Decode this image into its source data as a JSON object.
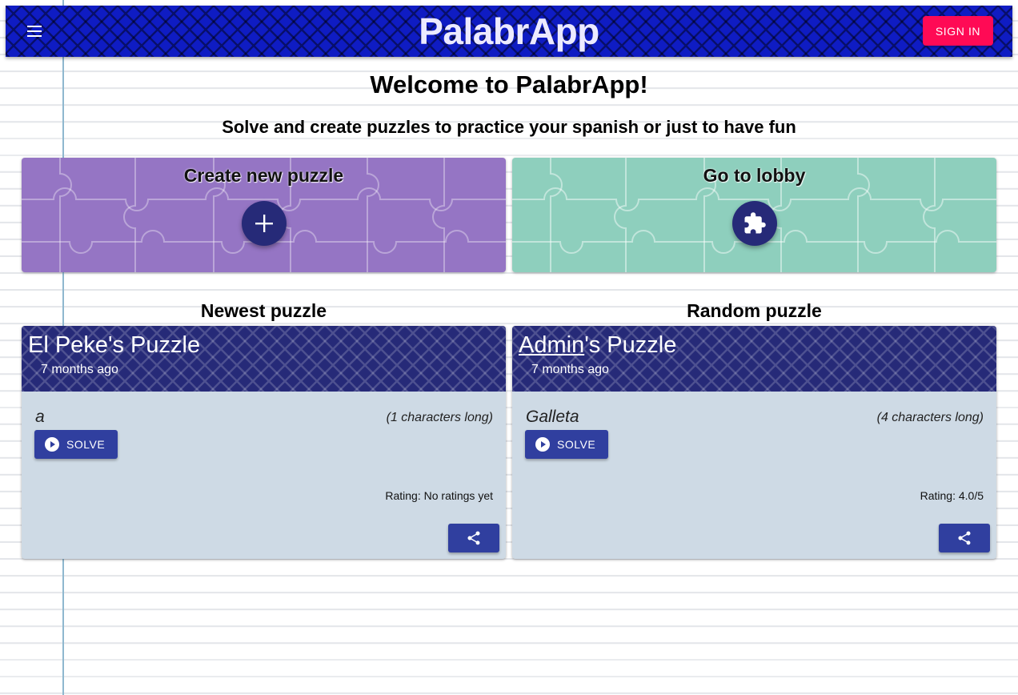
{
  "app_bar": {
    "title": "PalabrApp",
    "menu_icon": "hamburger-menu-icon",
    "sign_in_label": "SIGN IN",
    "bg_color": "#0f1cc3",
    "sign_in_color": "#ff0a55"
  },
  "hero": {
    "welcome": "Welcome to PalabrApp!",
    "tagline": "Solve and create puzzles to practice your spanish or just to have fun"
  },
  "actions": {
    "create": {
      "label": "Create new puzzle",
      "icon": "plus-icon",
      "color": "#9575c4"
    },
    "lobby": {
      "label": "Go to lobby",
      "icon": "puzzle-piece-icon",
      "color": "#8ecfbd"
    }
  },
  "newest": {
    "heading": "Newest puzzle",
    "author": "El Peke",
    "title_suffix": "'s Puzzle",
    "time": "7 months ago",
    "word": "a",
    "length": "(1 characters long)",
    "solve_label": "SOLVE",
    "rating": "Rating: No ratings yet",
    "share_icon": "share-icon"
  },
  "random": {
    "heading": "Random puzzle",
    "author": "Admin",
    "title_suffix": "'s Puzzle",
    "time": "7 months ago",
    "word": "Galleta",
    "length": "(4 characters long)",
    "solve_label": "SOLVE",
    "rating": "Rating: 4.0/5",
    "share_icon": "share-icon"
  }
}
